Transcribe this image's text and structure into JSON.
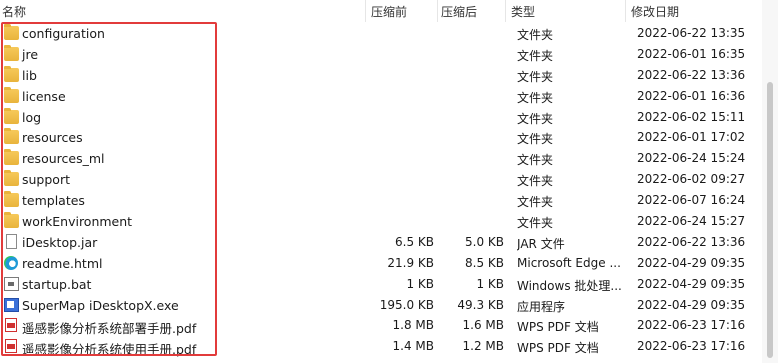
{
  "columns": {
    "name": "名称",
    "compressed": "压缩前",
    "size": "压缩后",
    "type": "类型",
    "modified": "修改日期"
  },
  "files": [
    {
      "name": "configuration",
      "compressed": "",
      "size": "",
      "type": "文件夹",
      "date": "2022-06-22 13:35",
      "icon": "folder-icon"
    },
    {
      "name": "jre",
      "compressed": "",
      "size": "",
      "type": "文件夹",
      "date": "2022-06-01 16:35",
      "icon": "folder-icon"
    },
    {
      "name": "lib",
      "compressed": "",
      "size": "",
      "type": "文件夹",
      "date": "2022-06-22 13:36",
      "icon": "folder-icon"
    },
    {
      "name": "license",
      "compressed": "",
      "size": "",
      "type": "文件夹",
      "date": "2022-06-01 16:36",
      "icon": "folder-icon"
    },
    {
      "name": "log",
      "compressed": "",
      "size": "",
      "type": "文件夹",
      "date": "2022-06-02 15:11",
      "icon": "folder-icon"
    },
    {
      "name": "resources",
      "compressed": "",
      "size": "",
      "type": "文件夹",
      "date": "2022-06-01 17:02",
      "icon": "folder-icon"
    },
    {
      "name": "resources_ml",
      "compressed": "",
      "size": "",
      "type": "文件夹",
      "date": "2022-06-24 15:24",
      "icon": "folder-icon"
    },
    {
      "name": "support",
      "compressed": "",
      "size": "",
      "type": "文件夹",
      "date": "2022-06-02 09:27",
      "icon": "folder-icon"
    },
    {
      "name": "templates",
      "compressed": "",
      "size": "",
      "type": "文件夹",
      "date": "2022-06-07 16:24",
      "icon": "folder-icon"
    },
    {
      "name": "workEnvironment",
      "compressed": "",
      "size": "",
      "type": "文件夹",
      "date": "2022-06-24 15:27",
      "icon": "folder-icon"
    },
    {
      "name": "iDesktop.jar",
      "compressed": "6.5 KB",
      "size": "5.0 KB",
      "type": "JAR 文件",
      "date": "2022-06-22 13:36",
      "icon": "file-icon"
    },
    {
      "name": "readme.html",
      "compressed": "21.9 KB",
      "size": "8.5 KB",
      "type": "Microsoft Edge ...",
      "date": "2022-04-29 09:35",
      "icon": "edge-icon"
    },
    {
      "name": "startup.bat",
      "compressed": "1 KB",
      "size": "1 KB",
      "type": "Windows 批处理...",
      "date": "2022-04-29 09:35",
      "icon": "bat-icon"
    },
    {
      "name": "SuperMap iDesktopX.exe",
      "compressed": "195.0 KB",
      "size": "49.3 KB",
      "type": "应用程序",
      "date": "2022-04-29 09:35",
      "icon": "exe-icon"
    },
    {
      "name": "遥感影像分析系统部署手册.pdf",
      "compressed": "1.8 MB",
      "size": "1.6 MB",
      "type": "WPS PDF 文档",
      "date": "2022-06-23 17:16",
      "icon": "pdf-icon"
    },
    {
      "name": "遥感影像分析系统使用手册.pdf",
      "compressed": "1.4 MB",
      "size": "1.2 MB",
      "type": "WPS PDF 文档",
      "date": "2022-06-23 17:16",
      "icon": "pdf-icon"
    }
  ],
  "colors": {
    "highlight": "#e23b3b",
    "folder": "#e9b43c"
  }
}
